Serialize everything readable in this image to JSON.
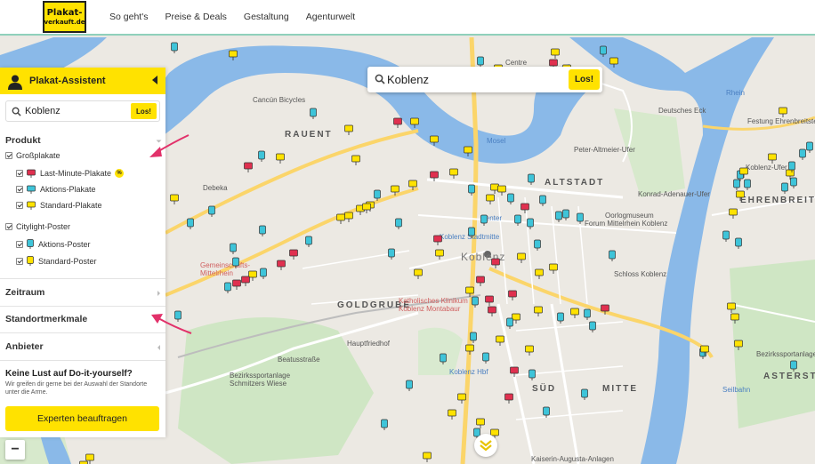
{
  "header": {
    "logo_line1": "Plakat-",
    "logo_line2": "verkauft.de",
    "nav": [
      "So geht's",
      "Preise & Deals",
      "Gestaltung",
      "Agenturwelt"
    ]
  },
  "map_search": {
    "value": "Koblenz",
    "button": "Los!"
  },
  "panel": {
    "title": "Plakat-Assistent",
    "search_value": "Koblenz",
    "search_button": "Los!",
    "sections": {
      "produkt": "Produkt",
      "zeitraum": "Zeitraum",
      "standortmerkmale": "Standortmerkmale",
      "anbieter": "Anbieter"
    },
    "grossplakate": {
      "label": "Großplakate",
      "items": [
        "Last-Minute-Plakate",
        "Aktions-Plakate",
        "Standard-Plakate"
      ],
      "badge": "%"
    },
    "citylight": {
      "label": "Citylight-Poster",
      "items": [
        "Aktions-Poster",
        "Standard-Poster"
      ]
    },
    "cta_title": "Keine Lust auf Do-it-yourself?",
    "cta_text": "Wir greifen dir gerne bei der Auswahl der Standorte unter die Arme.",
    "cta_button": "Experten beauftragen"
  },
  "zoom_out": "−",
  "map_labels": {
    "altstadt": "ALTSTADT",
    "rauental": "RAUENT",
    "goldgrube": "GOLDGRUBE",
    "sued": "SÜD",
    "mitte": "MITTE",
    "ehrenbreitstein": "EHRENBREITSTEIN",
    "asterstein": "ASTERSTEIN",
    "koblenz": "Koblenz",
    "mosel": "Mosel",
    "rhein": "Rhein",
    "deutsches_eck": "Deutsches Eck",
    "festung": "Festung Ehrenbreitstein",
    "koblenz_ufer": "Koblenz-Ufer",
    "konrad": "Konrad-Adenauer-Ufer",
    "oorlog": "Oorlogmuseum",
    "museum": "Forum Mittelrhein Koblenz",
    "schloss": "Schloss Koblenz",
    "stadtmitte": "Koblenz Stadtmitte",
    "hbf": "Koblenz Hbf",
    "hauptfriedhof": "Hauptfriedhof",
    "klinikum": "Katholisches Klinikum Koblenz Montabaur",
    "gemeinschaft": "Gemeinschafts-Mittelrhein",
    "schmitzers": "Bezirkssportanlage Schmitzers Wiese",
    "bezirks2": "Bezirkssportanlage",
    "debeka": "Debeka",
    "peter": "Peter-Altmeier-Ufer",
    "kaiserin": "Kaiserin-Augusta-Anlagen",
    "beatus": "Beatusstraße",
    "seilbahn": "Seilbahn",
    "cancun": "Cancún Bicycles",
    "center": "Center",
    "centre": "Centre"
  },
  "colors": {
    "accent": "#ffe200",
    "red_pin": "#e0304f",
    "cyan_pin": "#3ec4d9",
    "yellow_pin": "#ffe200",
    "water": "#8ab9e8",
    "road": "#fbd56a"
  }
}
